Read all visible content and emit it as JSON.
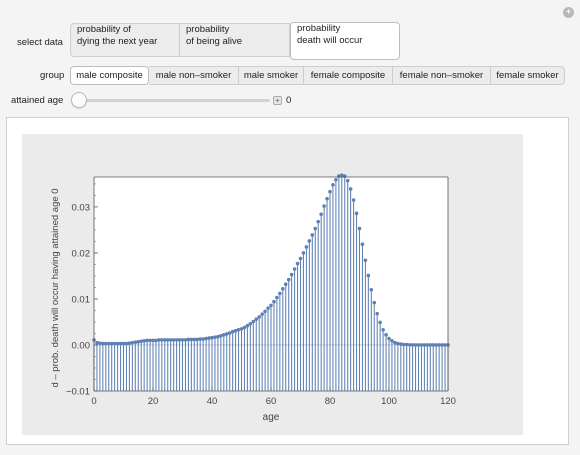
{
  "controls": {
    "select_data_label": "select data",
    "select_data_options": [
      {
        "line1": "probability of",
        "line2": "dying the next year",
        "selected": false
      },
      {
        "line1": "probability",
        "line2": "of being alive",
        "selected": false
      },
      {
        "line1": "probability",
        "line2": "death will occur",
        "selected": true
      }
    ],
    "group_label": "group",
    "group_options": [
      {
        "label": "male composite",
        "selected": true
      },
      {
        "label": "male non–smoker",
        "selected": false
      },
      {
        "label": "male smoker",
        "selected": false
      },
      {
        "label": "female composite",
        "selected": false
      },
      {
        "label": "female non–smoker",
        "selected": false
      },
      {
        "label": "female smoker",
        "selected": false
      }
    ],
    "age_label": "attained age",
    "age_value": "0",
    "age_fraction": 0
  },
  "chart_data": {
    "type": "line",
    "style": "stem plot with point markers",
    "xlabel": "age",
    "ylabel": "d – prob. death will occur having attained age 0",
    "xlim": [
      0,
      120
    ],
    "ylim": [
      -0.01,
      0.037
    ],
    "xticks": [
      "0",
      "20",
      "40",
      "60",
      "80",
      "100",
      "120"
    ],
    "yticks": [
      "−0.01",
      "0.00",
      "0.01",
      "0.02",
      "0.03"
    ],
    "color": "#5e81b5",
    "x": [
      0,
      1,
      2,
      3,
      4,
      5,
      6,
      7,
      8,
      9,
      10,
      11,
      12,
      13,
      14,
      15,
      16,
      17,
      18,
      19,
      20,
      21,
      22,
      23,
      24,
      25,
      26,
      27,
      28,
      29,
      30,
      31,
      32,
      33,
      34,
      35,
      36,
      37,
      38,
      39,
      40,
      41,
      42,
      43,
      44,
      45,
      46,
      47,
      48,
      49,
      50,
      51,
      52,
      53,
      54,
      55,
      56,
      57,
      58,
      59,
      60,
      61,
      62,
      63,
      64,
      65,
      66,
      67,
      68,
      69,
      70,
      71,
      72,
      73,
      74,
      75,
      76,
      77,
      78,
      79,
      80,
      81,
      82,
      83,
      84,
      85,
      86,
      87,
      88,
      89,
      90,
      91,
      92,
      93,
      94,
      95,
      96,
      97,
      98,
      99,
      100,
      101,
      102,
      103,
      104,
      105,
      106,
      107,
      108,
      109,
      110,
      111,
      112,
      113,
      114,
      115,
      116,
      117,
      118,
      119,
      120
    ],
    "y": [
      0.0011,
      0.0005,
      0.0004,
      0.0003,
      0.0003,
      0.0003,
      0.0003,
      0.0003,
      0.0003,
      0.0003,
      0.0003,
      0.0003,
      0.0004,
      0.0005,
      0.0006,
      0.0007,
      0.0008,
      0.0009,
      0.001,
      0.001,
      0.001,
      0.001,
      0.0011,
      0.0011,
      0.0011,
      0.0011,
      0.0011,
      0.0011,
      0.0011,
      0.0011,
      0.0011,
      0.0011,
      0.0012,
      0.0012,
      0.0012,
      0.0012,
      0.0013,
      0.0013,
      0.0014,
      0.0015,
      0.0016,
      0.0017,
      0.0018,
      0.002,
      0.0022,
      0.0024,
      0.0026,
      0.0029,
      0.0031,
      0.0033,
      0.0035,
      0.0038,
      0.0042,
      0.0046,
      0.0051,
      0.0056,
      0.0061,
      0.0067,
      0.0073,
      0.008,
      0.0086,
      0.0094,
      0.0103,
      0.0112,
      0.0122,
      0.0132,
      0.0142,
      0.0153,
      0.0165,
      0.0177,
      0.0188,
      0.02,
      0.0213,
      0.0226,
      0.0239,
      0.0253,
      0.0268,
      0.0284,
      0.0302,
      0.0318,
      0.0333,
      0.0348,
      0.0359,
      0.0367,
      0.0369,
      0.0367,
      0.0357,
      0.0339,
      0.0315,
      0.0286,
      0.0253,
      0.0219,
      0.0184,
      0.0151,
      0.012,
      0.0092,
      0.0068,
      0.0049,
      0.0033,
      0.0022,
      0.0014,
      0.0009,
      0.0005,
      0.0003,
      0.0002,
      0.0001,
      0.0001,
      5e-05,
      2e-05,
      0,
      0,
      0,
      0,
      0,
      0,
      0,
      0,
      0,
      0,
      0,
      0
    ]
  }
}
